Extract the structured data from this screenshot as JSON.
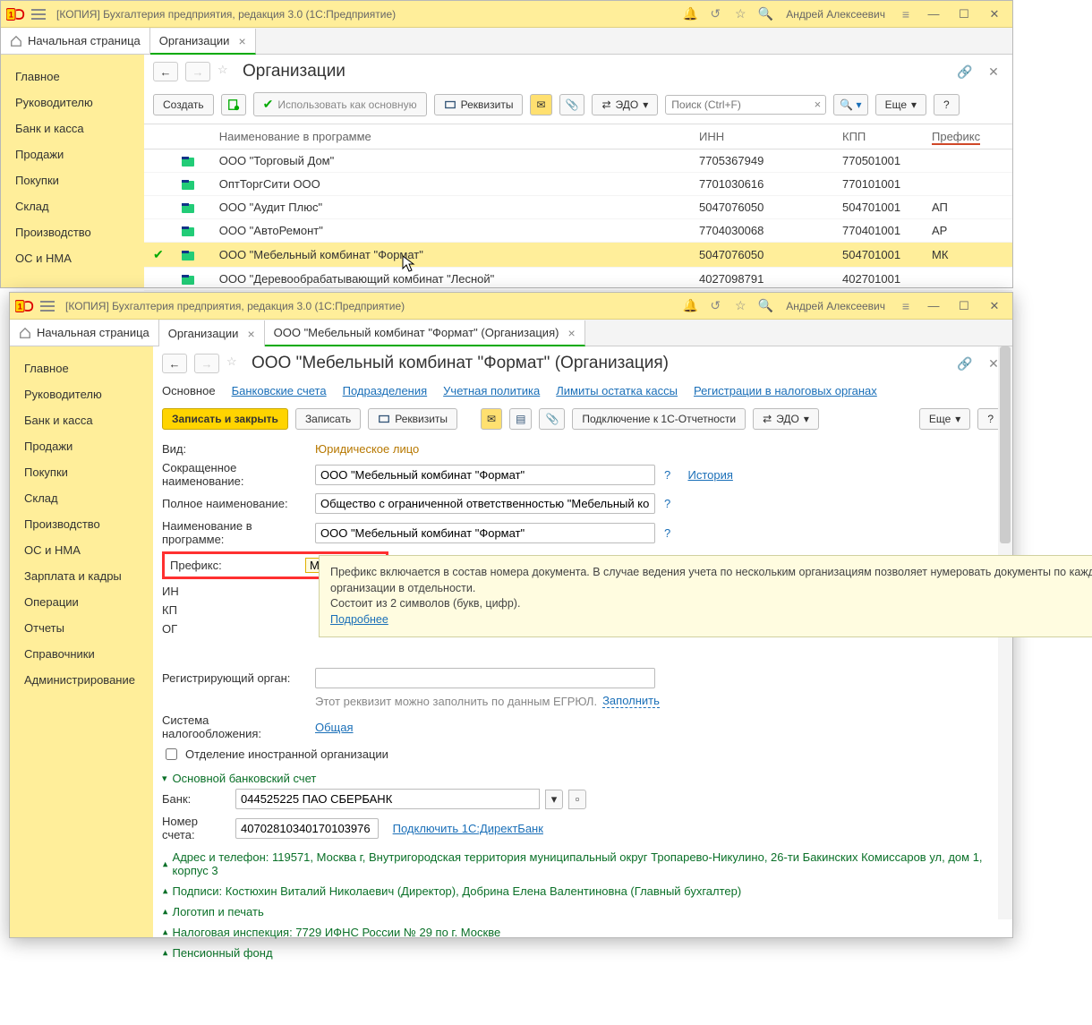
{
  "win1": {
    "title": "[КОПИЯ] Бухгалтерия предприятия, редакция 3.0  (1С:Предприятие)",
    "user": "Андрей Алексеевич",
    "home_tab": "Начальная страница",
    "tab1": "Организации",
    "sidebar": [
      "Главное",
      "Руководителю",
      "Банк и касса",
      "Продажи",
      "Покупки",
      "Склад",
      "Производство",
      "ОС и НМА"
    ],
    "page_title": "Организации",
    "toolbar": {
      "create": "Создать",
      "use_main": "Использовать как основную",
      "requisites": "Реквизиты",
      "edo": "ЭДО",
      "search_placeholder": "Поиск (Ctrl+F)",
      "more": "Еще",
      "help": "?"
    },
    "columns": {
      "name": "Наименование в программе",
      "inn": "ИНН",
      "kpp": "КПП",
      "prefix": "Префикс"
    },
    "rows": [
      {
        "name": "ООО \"Торговый Дом\"",
        "inn": "7705367949",
        "kpp": "770501001",
        "prefix": ""
      },
      {
        "name": "ОптТоргСити ООО",
        "inn": "7701030616",
        "kpp": "770101001",
        "prefix": ""
      },
      {
        "name": "ООО \"Аудит Плюс\"",
        "inn": "5047076050",
        "kpp": "504701001",
        "prefix": "АП"
      },
      {
        "name": "ООО \"АвтоРемонт\"",
        "inn": "7704030068",
        "kpp": "770401001",
        "prefix": "АР"
      },
      {
        "name": "ООО \"Мебельный комбинат \"Формат\"",
        "inn": "5047076050",
        "kpp": "504701001",
        "prefix": "МК",
        "selected": true,
        "checked": true
      },
      {
        "name": "ООО \"Деревообрабатывающий комбинат \"Лесной\"",
        "inn": "4027098791",
        "kpp": "402701001",
        "prefix": ""
      }
    ]
  },
  "win2": {
    "title": "[КОПИЯ] Бухгалтерия предприятия, редакция 3.0  (1С:Предприятие)",
    "user": "Андрей Алексеевич",
    "home_tab": "Начальная страница",
    "tab1": "Организации",
    "tab2": "ООО \"Мебельный комбинат \"Формат\" (Организация)",
    "sidebar": [
      "Главное",
      "Руководителю",
      "Банк и касса",
      "Продажи",
      "Покупки",
      "Склад",
      "Производство",
      "ОС и НМА",
      "Зарплата и кадры",
      "Операции",
      "Отчеты",
      "Справочники",
      "Администрирование"
    ],
    "page_title": "ООО \"Мебельный комбинат \"Формат\" (Организация)",
    "subtabs": {
      "main": "Основное",
      "bank": "Банковские счета",
      "depts": "Подразделения",
      "policy": "Учетная политика",
      "limits": "Лимиты остатка кассы",
      "reg": "Регистрации в налоговых органах"
    },
    "toolbar": {
      "save_close": "Записать и закрыть",
      "save": "Записать",
      "requisites": "Реквизиты",
      "connect": "Подключение к 1С-Отчетности",
      "edo": "ЭДО",
      "more": "Еще",
      "help": "?"
    },
    "labels": {
      "kind": "Вид:",
      "short": "Сокращенное наименование:",
      "full": "Полное наименование:",
      "prog": "Наименование в программе:",
      "prefix": "Префикс:",
      "inn": "ИН",
      "kpp": "КП",
      "ogrn": "ОГ",
      "regorg": "Регистрирующий орган:",
      "tax_sys": "Система налогообложения:",
      "foreign": "Отделение иностранной организации",
      "bank": "Банк:",
      "acct": "Номер счета:"
    },
    "values": {
      "kind": "Юридическое лицо",
      "short": "ООО \"Мебельный комбинат \"Формат\"",
      "full": "Общество с ограниченной ответственностью \"Мебельный комбинат",
      "prog": "ООО \"Мебельный комбинат \"Формат\"",
      "prefix": "МК",
      "bank": "044525225 ПАО СБЕРБАНК",
      "acct": "40702810340170103976"
    },
    "links": {
      "history": "История",
      "fill": "Заполнить",
      "tax_sys_val": "Общая",
      "directbank": "Подключить 1С:ДиректБанк",
      "more_link": "Подробнее"
    },
    "hint_fill": "Этот реквизит можно заполнить по данным ЕГРЮЛ. ",
    "tooltip": {
      "line1": "Префикс включается в состав номера документа. В случае ведения учета по нескольким организациям позволяет нумеровать документы по каждой организации в отдельности.",
      "line2": "Состоит из 2 символов (букв, цифр)."
    },
    "sections": {
      "bank": "Основной банковский счет",
      "addr": "Адрес и телефон: 119571, Москва г, Внутригородская территория муниципальный округ Тропарево-Никулино, 26-ти Бакинских Комиссаров ул, дом 1, корпус 3",
      "sign": "Подписи: Костюхин Виталий Николаевич (Директор), Добрина Елена Валентиновна (Главный бухгалтер)",
      "logo": "Логотип и печать",
      "tax": "Налоговая инспекция: 7729 ИФНС России № 29 по г. Москве",
      "pension": "Пенсионный фонд"
    }
  }
}
